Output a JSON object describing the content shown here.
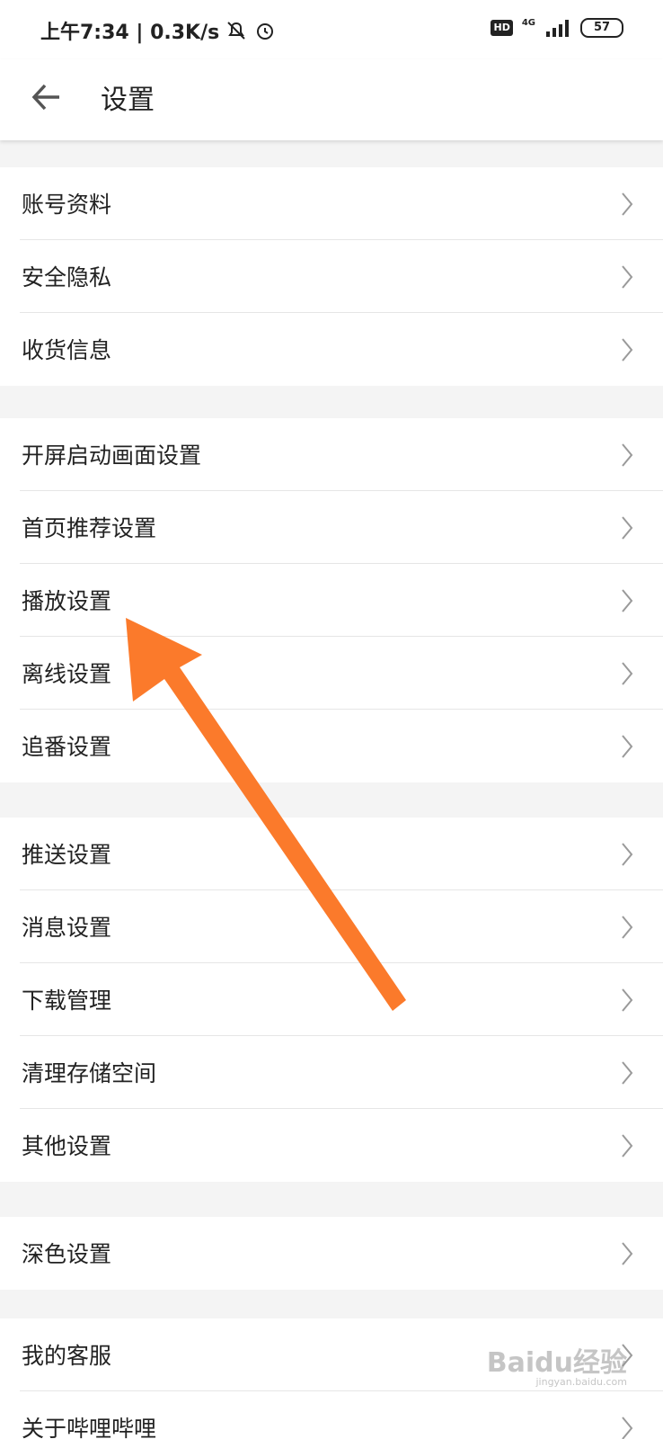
{
  "status_bar": {
    "time": "上午7:34 | 0.3K/s",
    "hd": "HD",
    "network": "4G",
    "battery": "57"
  },
  "header": {
    "title": "设置"
  },
  "groups": [
    {
      "items": [
        {
          "label": "账号资料"
        },
        {
          "label": "安全隐私"
        },
        {
          "label": "收货信息"
        }
      ]
    },
    {
      "items": [
        {
          "label": "开屏启动画面设置"
        },
        {
          "label": "首页推荐设置"
        },
        {
          "label": "播放设置"
        },
        {
          "label": "离线设置"
        },
        {
          "label": "追番设置"
        }
      ]
    },
    {
      "items": [
        {
          "label": "推送设置"
        },
        {
          "label": "消息设置"
        },
        {
          "label": "下载管理"
        },
        {
          "label": "清理存储空间"
        },
        {
          "label": "其他设置"
        }
      ]
    },
    {
      "items": [
        {
          "label": "深色设置"
        }
      ]
    },
    {
      "items": [
        {
          "label": "我的客服"
        },
        {
          "label": "关于哔哩哔哩"
        }
      ]
    }
  ],
  "watermark": {
    "text": "Baidu经验",
    "sub": "jingyan.baidu.com"
  },
  "colors": {
    "annotation_arrow": "#fb7a2b",
    "background": "#f4f4f4"
  }
}
